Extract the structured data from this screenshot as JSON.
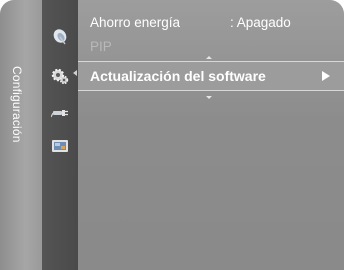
{
  "sidebar": {
    "title": "Configuración"
  },
  "icons": [
    {
      "name": "satellite-dish-icon"
    },
    {
      "name": "gear-settings-icon"
    },
    {
      "name": "input-plug-icon"
    },
    {
      "name": "application-icon"
    }
  ],
  "menu": {
    "items": [
      {
        "label": "Ahorro energía",
        "value": ": Apagado",
        "state": "normal"
      },
      {
        "label": "PIP",
        "value": "",
        "state": "disabled"
      },
      {
        "label": "Actualización del software",
        "value": "",
        "state": "selected"
      }
    ]
  },
  "colors": {
    "panel": "#8c8c8c",
    "icon_column": "#4e4e4e",
    "title_strip": "#a0a0a0",
    "text": "#ffffff"
  }
}
